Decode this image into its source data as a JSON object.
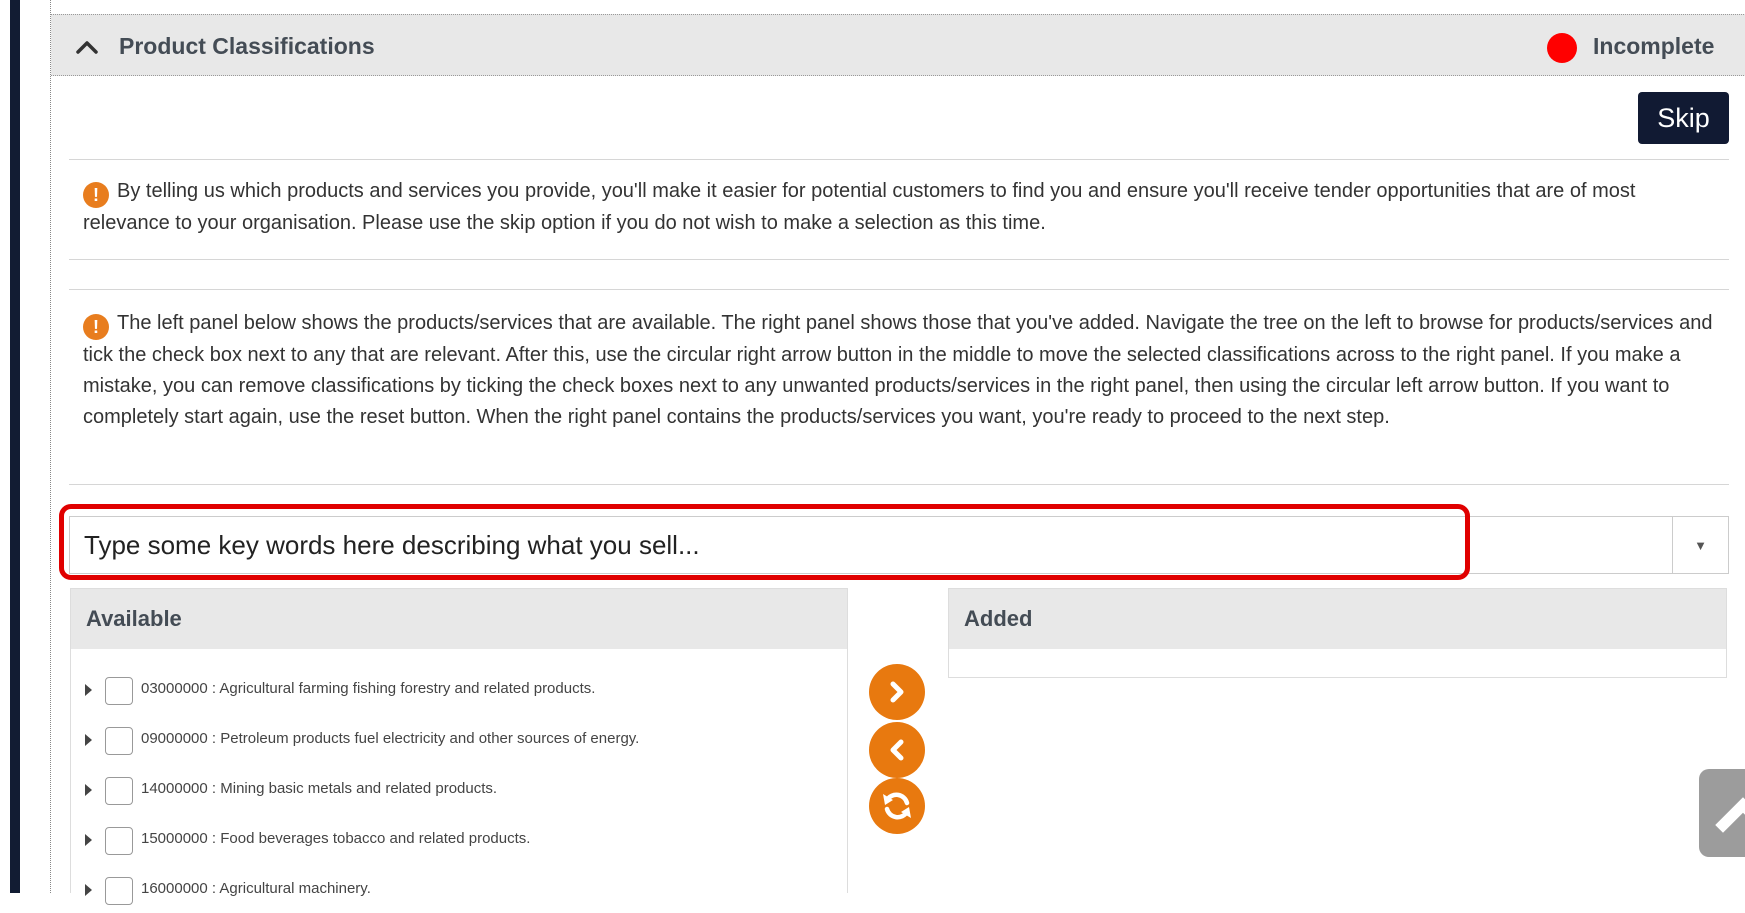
{
  "header": {
    "title": "Product Classifications",
    "status": "Incomplete",
    "status_color": "#ff0000"
  },
  "actions": {
    "skip_label": "Skip"
  },
  "info": {
    "paragraph_1": "By telling us which products and services you provide, you'll make it easier for potential customers to find you and ensure you'll receive tender opportunities that are of most relevance to your organisation. Please use the skip option if you do not wish to make a selection as this time.",
    "paragraph_2": "The left panel below shows the products/services that are available. The right panel shows those that you've added. Navigate the tree on the left to browse for products/services and tick the check box next to any that are relevant. After this, use the circular right arrow button in the middle to move the selected classifications across to the right panel. If you make a mistake, you can remove classifications by ticking the check boxes next to any unwanted products/services in the right panel, then using the circular left arrow button. If you want to completely start again, use the reset button. When the right panel contains the products/services you want, you're ready to proceed to the next step."
  },
  "search": {
    "placeholder": "Type some key words here describing what you sell...",
    "value": ""
  },
  "available": {
    "heading": "Available",
    "items": [
      {
        "label": "03000000 : Agricultural farming fishing forestry and related products."
      },
      {
        "label": "09000000 : Petroleum products fuel electricity and other sources of energy."
      },
      {
        "label": "14000000 : Mining basic metals and related products."
      },
      {
        "label": "15000000 : Food beverages tobacco and related products."
      },
      {
        "label": "16000000 : Agricultural machinery."
      }
    ]
  },
  "added": {
    "heading": "Added",
    "items": []
  },
  "transfer_controls": {
    "accent_color": "#e8790f",
    "move_right_icon": "chevron-right-icon",
    "move_left_icon": "chevron-left-icon",
    "reset_icon": "refresh-icon"
  },
  "scroll_top_icon": "chevron-up-icon"
}
